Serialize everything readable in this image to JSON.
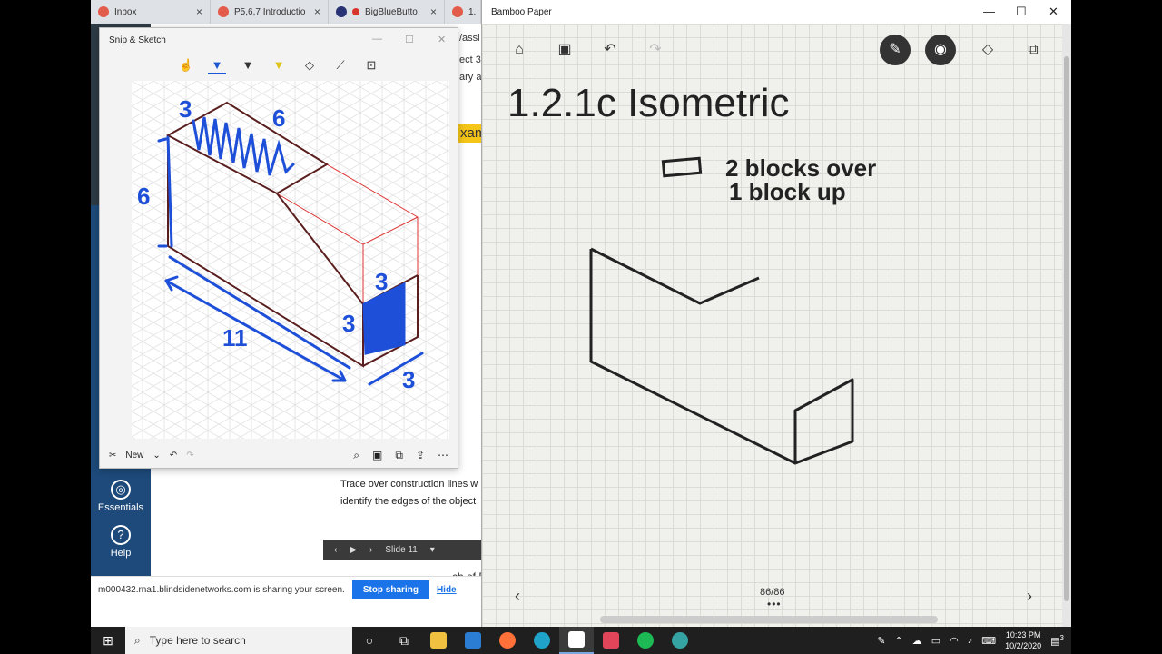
{
  "browser_tabs": [
    {
      "label": "Inbox",
      "close": "×"
    },
    {
      "label": "P5,6,7 Introductio",
      "close": "×"
    },
    {
      "label": "BigBlueButto",
      "close": "×"
    },
    {
      "label": "1.",
      "close": ""
    }
  ],
  "lms": {
    "essentials_label": "Essentials",
    "help_label": "Help",
    "help_glyph": "?",
    "fragments": [
      "/assi",
      "ect 3",
      "ary a",
      "xam"
    ],
    "slide_text_line1": "Trace over construction lines w",
    "slide_text_line2": "identify the edges of the object",
    "slide_label": "Slide 11",
    "bottom_fragment": "ch of Fo"
  },
  "share_bar": {
    "message": "m000432.rna1.blindsidenetworks.com is sharing your screen.",
    "stop_label": "Stop sharing",
    "hide_label": "Hide"
  },
  "snip": {
    "title": "Snip & Sketch",
    "new_label": "New",
    "tool_icons": [
      "touch-writing-icon",
      "ballpoint-pen-icon",
      "pencil-icon",
      "highlighter-icon",
      "eraser-icon",
      "ruler-icon",
      "crop-icon"
    ],
    "dim_labels": [
      "3",
      "6",
      "6",
      "3",
      "3",
      "11",
      "3"
    ]
  },
  "bamboo": {
    "title": "Bamboo Paper",
    "heading": "1.2.1c Isometric",
    "note_line1": "2 blocks over",
    "note_line2": "1 block up",
    "page_indicator": "86/86",
    "page_dots": "•••",
    "prev_arrow": "‹",
    "next_arrow": "›"
  },
  "taskbar": {
    "search_placeholder": "Type here to search",
    "time": "10:23 PM",
    "date": "10/2/2020",
    "notification_count": "3"
  },
  "colors": {
    "accent_blue": "#1a73e8",
    "ink_blue": "#1d4fd8",
    "ink_dark_red": "#5a1e1e",
    "ink_red": "#d33",
    "lms_nav": "#1d4a7a"
  }
}
